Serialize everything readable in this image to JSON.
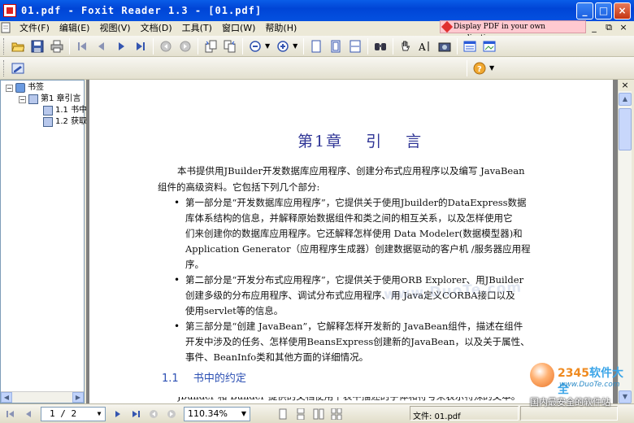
{
  "window": {
    "title": "01.pdf - Foxit Reader 1.3 - [01.pdf]",
    "controls": [
      "_",
      "□",
      "×"
    ]
  },
  "menubar": {
    "items": [
      "文件(F)",
      "编辑(E)",
      "视图(V)",
      "文档(D)",
      "工具(T)",
      "窗口(W)",
      "帮助(H)"
    ],
    "promo": "Display PDF in your own applications",
    "mdi_controls": [
      "_",
      "⧉",
      "×"
    ]
  },
  "toolbar": {
    "icons": [
      "open-icon",
      "save-icon",
      "print-icon",
      "first-page-icon",
      "prev-page-icon",
      "next-page-icon",
      "last-page-icon",
      "back-icon",
      "forward-icon",
      "rotate-left-icon",
      "rotate-right-icon",
      "zoom-out-icon",
      "zoom-in-icon",
      "actual-size-icon",
      "fit-page-icon",
      "fit-width-icon",
      "find-icon",
      "hand-tool-icon",
      "text-select-icon",
      "snapshot-icon",
      "bookmark-panel-icon",
      "thumbnail-icon",
      "help-icon"
    ]
  },
  "bookmarks": {
    "root": "书签",
    "items": [
      {
        "label": "第1 章引言",
        "level": 1
      },
      {
        "label": "1.1 书中",
        "level": 2
      },
      {
        "label": "1.2 获取",
        "level": 2
      }
    ]
  },
  "document": {
    "chapter_title": "第1章  引    言",
    "intro_lines": [
      "本书提供用JBuilder开发数据库应用程序、创建分布式应用程序以及编写 JavaBean",
      "组件的高级资料。它包括下列几个部分:"
    ],
    "bullets": [
      {
        "lines": [
          "第一部分是“开发数据库应用程序”，它提供关于使用Jbuilder的DataExpress数据",
          "库体系结构的信息，并解释原始数据组件和类之间的相互关系，以及怎样使用它",
          "们来创建你的数据库应用程序。它还解释怎样使用  Data Modeler(数据模型器)和",
          "Application Generator（应用程序生成器）创建数据驱动的客户机 /服务器应用程",
          "序。"
        ]
      },
      {
        "lines": [
          "第二部分是“开发分布式应用程序”，它提供关于使用ORB Explorer、用JBuilder",
          "创建多级的分布应用程序、调试分布式应用程序、用  Java定义CORBA接口以及",
          "使用servlet等的信息。"
        ]
      },
      {
        "lines": [
          "第三部分是“创建 JavaBean”，它解释怎样开发新的 JavaBean组件，描述在组件",
          "开发中涉及的任务、怎样使用BeansExpress创建新的JavaBean，以及关于属性、",
          "事件、BeanInfo类和其他方面的详细情况。"
        ]
      }
    ],
    "section_number": "1.1",
    "section_title": "书中的约定",
    "partial_line": "Jbuilder 和 Builder 提供的文档使用下表中描述的字体和符号来表示特殊的文本。"
  },
  "statusbar": {
    "page_value": "1 / 2",
    "zoom_value": "110.34%",
    "file_label": "文件: 01.pdf"
  },
  "watermark": {
    "center": "www.DuoTe.com",
    "brand_a": "2345",
    "brand_b": "软件大全",
    "site": "www.DuoTe.com",
    "slogan": "国内最安全的软件站"
  }
}
